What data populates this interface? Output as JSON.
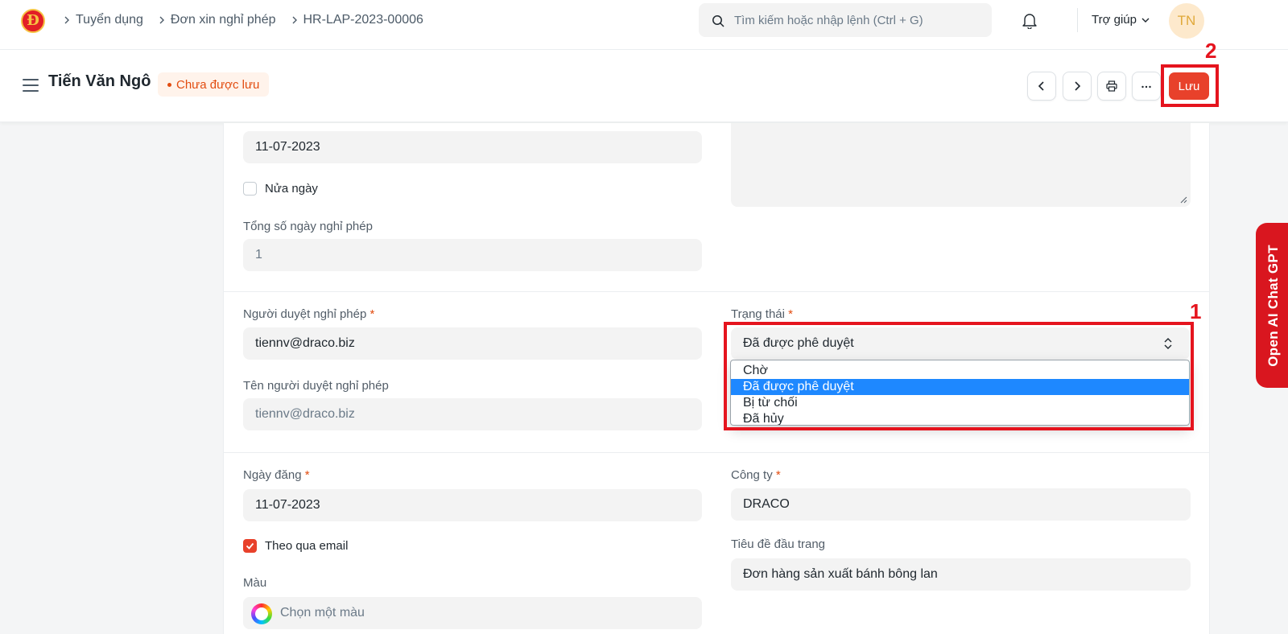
{
  "navbar": {
    "logo_text": "Đ",
    "breadcrumbs": [
      "Tuyển dụng",
      "Đơn xin nghỉ phép",
      "HR-LAP-2023-00006"
    ],
    "search_placeholder": "Tìm kiếm hoặc nhập lệnh (Ctrl + G)",
    "help_label": "Trợ giúp",
    "avatar_initials": "TN"
  },
  "header": {
    "title": "Tiến Văn Ngô",
    "status_badge": "Chưa được lưu",
    "save_label": "Lưu"
  },
  "annotations": {
    "first": "1",
    "second": "2"
  },
  "form": {
    "to_date_value": "11-07-2023",
    "half_day_label": "Nửa ngày",
    "half_day_checked": false,
    "total_days_label": "Tổng số ngày nghỉ phép",
    "total_days_value": "1",
    "approver_label": "Người duyệt nghỉ phép",
    "approver_value": "tiennv@draco.biz",
    "approver_name_label": "Tên người duyệt nghỉ phép",
    "approver_name_value": "tiennv@draco.biz",
    "status_label": "Trạng thái",
    "status_value": "Đã được phê duyệt",
    "status_options": [
      "Chờ",
      "Đã được phê duyệt",
      "Bị từ chối",
      "Đã hủy"
    ],
    "posting_date_label": "Ngày đăng",
    "posting_date_value": "11-07-2023",
    "company_label": "Công ty",
    "company_value": "DRACO",
    "follow_email_label": "Theo qua email",
    "follow_email_checked": true,
    "letter_head_label": "Tiêu đề đầu trang",
    "letter_head_value": "Đơn hàng sản xuất bánh bông lan",
    "color_label": "Màu",
    "color_placeholder": "Chọn một màu",
    "required_mark": "*"
  },
  "side_tab": {
    "label": "Open AI Chat GPT"
  },
  "colors": {
    "primary_button": "#e8412b",
    "unsaved_text": "#e24c10",
    "annotation": "#e5141e",
    "selected_option": "#1e88ff",
    "side_tab": "#d9161f"
  }
}
